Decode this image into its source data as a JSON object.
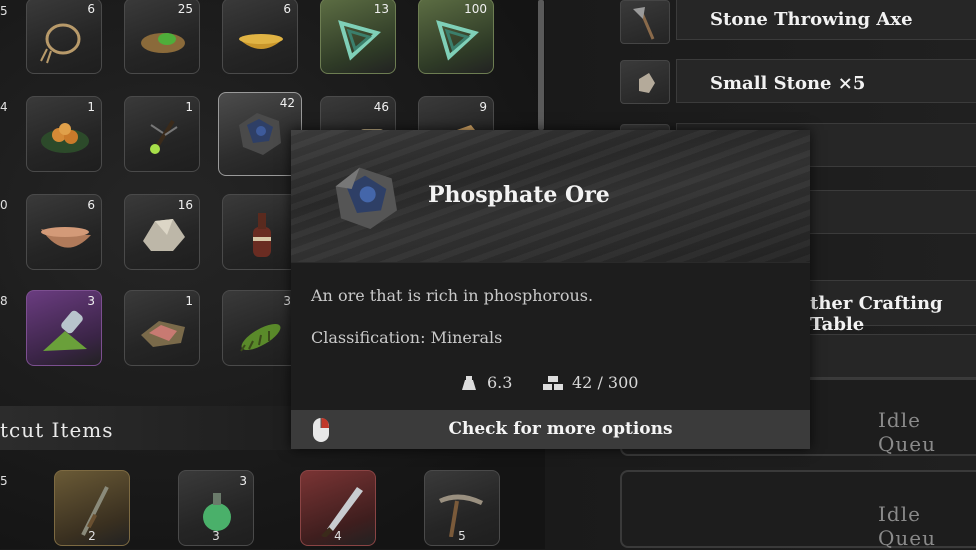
{
  "inventory": {
    "row1": [
      {
        "count": "6",
        "icon": "rope-icon"
      },
      {
        "count": "25",
        "icon": "flatbread-icon"
      },
      {
        "count": "6",
        "icon": "golden-bowl-icon"
      },
      {
        "count": "13",
        "icon": "crystal-frame-icon"
      },
      {
        "count": "100",
        "icon": "crystal-frame-icon"
      }
    ],
    "row2": [
      {
        "count": "1",
        "icon": "food-plate-icon"
      },
      {
        "count": "1",
        "icon": "firefly-icon"
      },
      {
        "count": "42",
        "icon": "phosphate-ore-icon"
      },
      {
        "count": "46",
        "icon": "scroll-icon"
      },
      {
        "count": "9",
        "icon": "parchment-icon"
      }
    ],
    "row3": [
      {
        "count": "6",
        "icon": "wooden-bowl-icon"
      },
      {
        "count": "16",
        "icon": "stone-chunk-icon"
      },
      {
        "count": "",
        "icon": "bottle-icon"
      }
    ],
    "row4": [
      {
        "count": "3",
        "icon": "potion-spill-icon"
      },
      {
        "count": "1",
        "icon": "raw-meat-icon"
      },
      {
        "count": "3",
        "icon": "centipede-icon"
      }
    ],
    "edge_counts": [
      "4",
      "0",
      "8",
      "5"
    ]
  },
  "shortcut": {
    "title": "tcut Items",
    "slots": [
      {
        "hotkey": "2",
        "count": "",
        "icon": "sword-icon"
      },
      {
        "hotkey": "3",
        "count": "3",
        "icon": "green-potion-icon"
      },
      {
        "hotkey": "4",
        "count": "",
        "icon": "machete-icon"
      },
      {
        "hotkey": "5",
        "count": "",
        "icon": "pickaxe-icon"
      }
    ]
  },
  "crafting": {
    "items": [
      {
        "label": "Stone Throwing Axe",
        "icon": "throwing-axe-icon"
      },
      {
        "label": "Small Stone ×5",
        "icon": "small-stone-icon"
      }
    ],
    "partial_label": "ther Crafting Table",
    "queues": [
      "Idle Queu",
      "Idle Queu"
    ]
  },
  "tooltip": {
    "name": "Phosphate Ore",
    "description": "An ore that is rich in phosphorous.",
    "classification": "Classification: Minerals",
    "weight": "6.3",
    "stack": "42 / 300",
    "footer": "Check for more options"
  },
  "colors": {
    "accent_green": "#5c6d43",
    "accent_purple": "#6a3c80",
    "mouse_accent": "#c0392b"
  }
}
